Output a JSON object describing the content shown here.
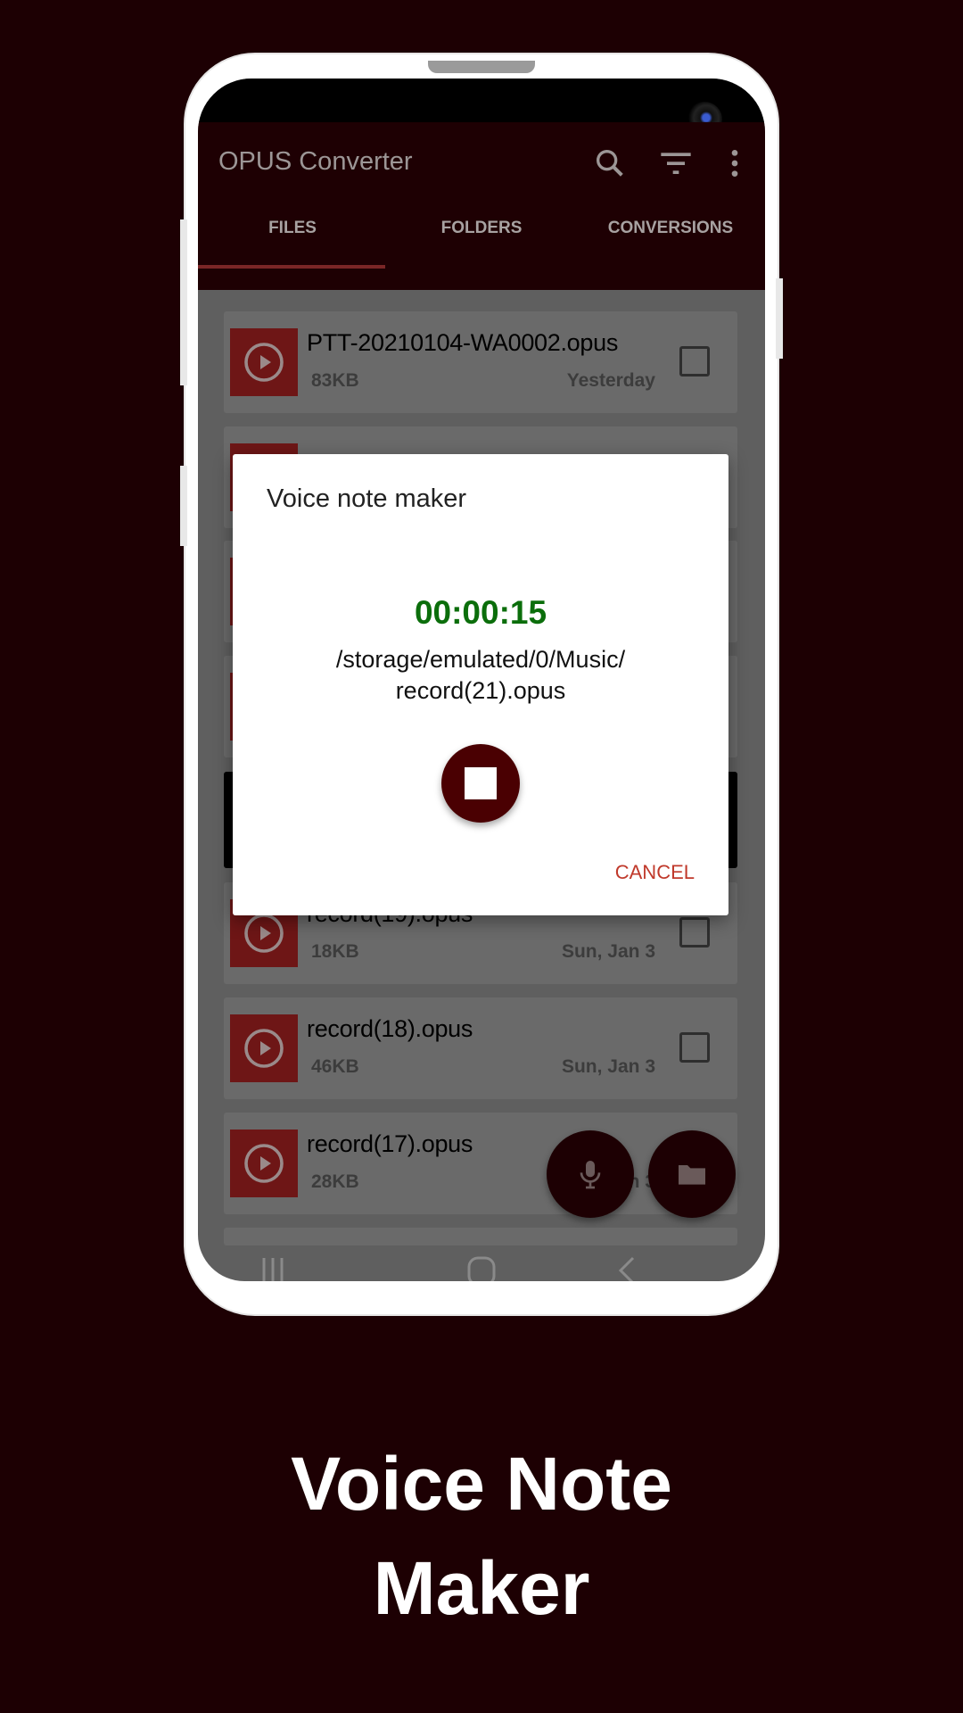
{
  "app": {
    "title": "OPUS Converter",
    "icons": [
      "search-icon",
      "filter-icon",
      "more-vert-icon"
    ],
    "tabs": [
      {
        "label": "FILES",
        "active": true
      },
      {
        "label": "FOLDERS",
        "active": false
      },
      {
        "label": "CONVERSIONS",
        "active": false
      }
    ]
  },
  "files": [
    {
      "name": "PTT-20210104-WA0002.opus",
      "size": "83KB",
      "date": "Yesterday"
    },
    {
      "name": "record(19).opus",
      "size": "18KB",
      "date": "Sun, Jan 3"
    },
    {
      "name": "record(18).opus",
      "size": "46KB",
      "date": "Sun, Jan 3"
    },
    {
      "name": "record(17).opus",
      "size": "28KB",
      "date": "Sun, Jan 3"
    }
  ],
  "dialog": {
    "title": "Voice note maker",
    "timer": "00:00:15",
    "path_line1": "/storage/emulated/0/Music/",
    "path_line2": "record(21).opus",
    "cancel_label": "CANCEL"
  },
  "colors": {
    "background": "#1d0003",
    "accent": "#4a0002",
    "timer": "#0b6e0b",
    "cancel": "#c0392b"
  },
  "caption": {
    "line1": "Voice Note",
    "line2": "Maker"
  }
}
